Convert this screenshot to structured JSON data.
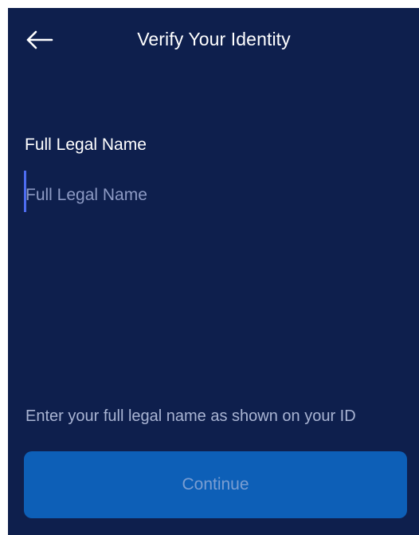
{
  "header": {
    "title": "Verify Your Identity",
    "back_icon": "arrow-left-icon"
  },
  "form": {
    "name_label": "Full Legal Name",
    "name_placeholder": "Full Legal Name",
    "name_value": "",
    "helper_text": "Enter your full legal name as shown on your ID"
  },
  "actions": {
    "continue_label": "Continue",
    "continue_enabled": false
  },
  "colors": {
    "background": "#0e1f4d",
    "button": "#0d5fb7",
    "caret": "#4d6cf0"
  }
}
